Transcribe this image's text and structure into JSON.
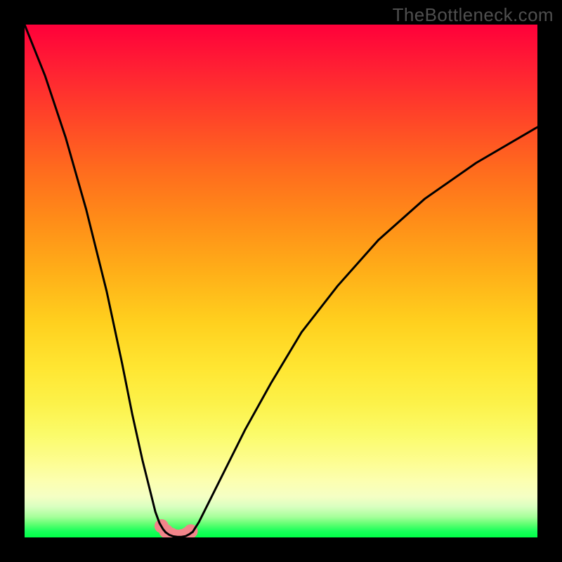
{
  "watermark": "TheBottleneck.com",
  "chart_data": {
    "type": "line",
    "title": "",
    "xlabel": "",
    "ylabel": "",
    "xlim": [
      0,
      100
    ],
    "ylim": [
      0,
      100
    ],
    "grid": false,
    "legend": false,
    "series": [
      {
        "name": "left-branch",
        "x": [
          0,
          4,
          8,
          12,
          16,
          19,
          21,
          23,
          24.5,
          25.5,
          26.3,
          27,
          27.5
        ],
        "y": [
          100,
          90,
          78,
          64,
          48,
          34,
          24,
          15,
          9,
          5,
          2.8,
          1.6,
          1
        ]
      },
      {
        "name": "valley",
        "x": [
          27.5,
          28.2,
          29,
          29.8,
          30.6,
          31.4,
          32.1,
          32.8
        ],
        "y": [
          1,
          0.5,
          0.2,
          0.1,
          0.1,
          0.25,
          0.6,
          1.1
        ]
      },
      {
        "name": "right-branch",
        "x": [
          32.8,
          34,
          36,
          39,
          43,
          48,
          54,
          61,
          69,
          78,
          88,
          100
        ],
        "y": [
          1.1,
          3,
          7,
          13,
          21,
          30,
          40,
          49,
          58,
          66,
          73,
          80
        ]
      },
      {
        "name": "left-marker-fill",
        "markers_only": true,
        "x": [
          26.7,
          27.6,
          28.6,
          29.6,
          30.6,
          31.6,
          32.4
        ],
        "y": [
          2.2,
          1.2,
          0.55,
          0.2,
          0.25,
          0.6,
          1.2
        ]
      }
    ],
    "markers": {
      "color": "#f2858a",
      "radius_px": 10
    },
    "curve_style": {
      "stroke": "#000000",
      "stroke_width_px": 3
    }
  }
}
